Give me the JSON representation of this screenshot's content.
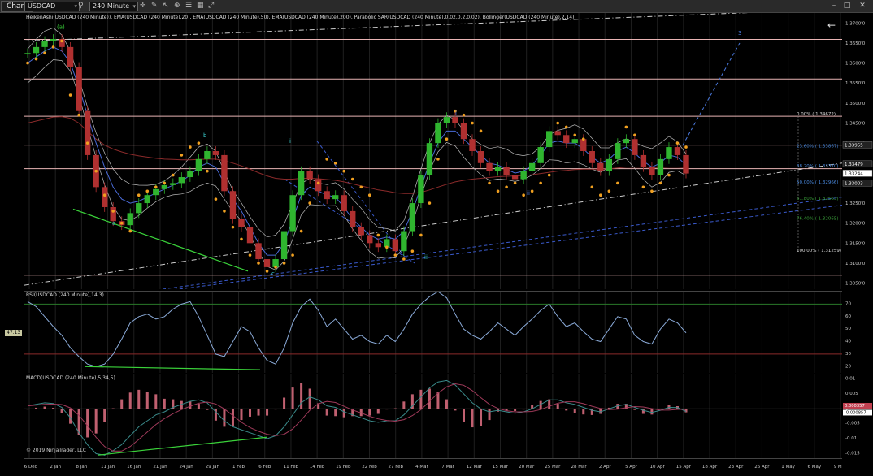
{
  "toolbar": {
    "chart_tab": "Chart",
    "instrument": "USDCAD",
    "timeframe": "240 Minute",
    "icons": [
      "search-icon",
      "crosshair-icon",
      "draw-tools-icon",
      "pointer-icon",
      "zoom-icon",
      "properties-icon"
    ]
  },
  "colors": {
    "background": "#000000",
    "grid": "#1f1f1f",
    "candle_up": "#2fb52f",
    "candle_down": "#b03030",
    "psar": "#f0a020",
    "ema20": "#4a6bd8",
    "ema50": "#2a3a8a",
    "ema200": "#8a2a2a",
    "bollinger": "#bbbbbb",
    "sr_line": "#e8b4b4",
    "fib_text": "#4a8ae0",
    "trend_green": "#3ad23a",
    "rsi_line": "#8aaad8",
    "macd_hist": "#c06070"
  },
  "chart_data": [
    {
      "type": "line",
      "panel": "price",
      "title": "HeikenAshi(USDCAD (240 Minute)), EMA(USDCAD (240 Minute),20), EMA(USDCAD (240 Minute),50), EMA(USDCAD (240 Minute),200), Parabolic SAR(USDCAD (240 Minute),0.02,0.2,0.02), Bollinger(USDCAD (240 Minute),2,14)",
      "x_tick_labels": [
        "26 Dec",
        "2 Jan",
        "8 Jan",
        "11 Jan",
        "16 Jan",
        "21 Jan",
        "24 Jan",
        "29 Jan",
        "1 Feb",
        "6 Feb",
        "11 Feb",
        "14 Feb",
        "19 Feb",
        "22 Feb",
        "27 Feb",
        "4 Mar",
        "7 Mar",
        "12 Mar",
        "15 Mar",
        "20 Mar",
        "25 Mar",
        "28 Mar",
        "2 Apr",
        "5 Apr",
        "10 Apr",
        "15 Apr",
        "18 Apr",
        "23 Apr",
        "26 Apr",
        "1 May",
        "6 May",
        "9 May"
      ],
      "y_tick_labels": [
        "1.3700'0",
        "1.3650'0",
        "1.3600'0",
        "1.3550'0",
        "1.3500'0",
        "1.3450'0",
        "1.3400'0",
        "1.3350'0",
        "1.3300'0",
        "1.3250'0",
        "1.3200'0",
        "1.3150'0",
        "1.3100'0",
        "1.3050'0"
      ],
      "ylim": [
        1.3035,
        1.3725
      ],
      "last_price_labels": [
        "1.33955",
        "1.33479",
        "1.33244",
        "1.33003"
      ],
      "series_close": [
        1.3625,
        1.364,
        1.3655,
        1.366,
        1.364,
        1.359,
        1.348,
        1.337,
        1.329,
        1.324,
        1.3205,
        1.3195,
        1.3225,
        1.325,
        1.327,
        1.3285,
        1.3295,
        1.33,
        1.3315,
        1.333,
        1.336,
        1.338,
        1.337,
        1.328,
        1.321,
        1.319,
        1.315,
        1.311,
        1.309,
        1.311,
        1.318,
        1.327,
        1.333,
        1.331,
        1.328,
        1.326,
        1.327,
        1.323,
        1.319,
        1.317,
        1.315,
        1.314,
        1.316,
        1.313,
        1.318,
        1.325,
        1.332,
        1.34,
        1.345,
        1.3465,
        1.345,
        1.341,
        1.338,
        1.335,
        1.333,
        1.334,
        1.332,
        1.331,
        1.333,
        1.335,
        1.339,
        1.343,
        1.342,
        1.34,
        1.341,
        1.338,
        1.335,
        1.333,
        1.336,
        1.34,
        1.341,
        1.337,
        1.334,
        1.332,
        1.336,
        1.339,
        1.337,
        1.3324
      ],
      "series_psar": [
        1.36,
        1.361,
        1.3625,
        1.364,
        1.3655,
        1.352,
        1.347,
        1.34,
        1.333,
        1.327,
        1.323,
        1.32,
        1.318,
        1.327,
        1.328,
        1.329,
        1.33,
        1.332,
        1.337,
        1.339,
        1.34,
        1.333,
        1.326,
        1.323,
        1.319,
        1.316,
        1.312,
        1.31,
        1.308,
        1.309,
        1.31,
        1.312,
        1.318,
        1.325,
        1.33,
        1.336,
        1.335,
        1.333,
        1.331,
        1.329,
        1.327,
        1.317,
        1.314,
        1.312,
        1.311,
        1.313,
        1.317,
        1.325,
        1.336,
        1.341,
        1.348,
        1.347,
        1.345,
        1.343,
        1.33,
        1.328,
        1.329,
        1.33,
        1.327,
        1.328,
        1.33,
        1.332,
        1.345,
        1.344,
        1.342,
        1.341,
        1.329,
        1.327,
        1.328,
        1.33,
        1.344,
        1.342,
        1.329,
        1.328,
        1.33,
        1.332,
        1.34,
        1.339
      ],
      "ema20": [
        1.36,
        1.3615,
        1.363,
        1.364,
        1.363,
        1.36,
        1.354,
        1.347,
        1.34,
        1.334,
        1.329,
        1.326,
        1.325,
        1.3255,
        1.3265,
        1.3275,
        1.3285,
        1.3295,
        1.3305,
        1.332,
        1.334,
        1.335,
        1.334,
        1.33,
        1.326,
        1.323,
        1.319,
        1.315,
        1.312,
        1.312,
        1.315,
        1.321,
        1.327,
        1.329,
        1.328,
        1.327,
        1.3265,
        1.324,
        1.321,
        1.319,
        1.317,
        1.316,
        1.3165,
        1.316,
        1.318,
        1.323,
        1.329,
        1.335,
        1.34,
        1.343,
        1.343,
        1.341,
        1.339,
        1.337,
        1.335,
        1.3345,
        1.3335,
        1.3325,
        1.333,
        1.3345,
        1.337,
        1.34,
        1.3405,
        1.34,
        1.34,
        1.3385,
        1.3365,
        1.335,
        1.336,
        1.338,
        1.339,
        1.3375,
        1.3355,
        1.334,
        1.335,
        1.337,
        1.3365,
        1.3345
      ],
      "ema200": [
        1.345,
        1.3455,
        1.346,
        1.3465,
        1.3466,
        1.3462,
        1.345,
        1.343,
        1.341,
        1.3395,
        1.3385,
        1.3378,
        1.3372,
        1.3368,
        1.3365,
        1.3362,
        1.336,
        1.3359,
        1.3358,
        1.3358,
        1.3359,
        1.336,
        1.336,
        1.3356,
        1.335,
        1.3343,
        1.3335,
        1.3326,
        1.3318,
        1.3312,
        1.331,
        1.331,
        1.3312,
        1.3312,
        1.3311,
        1.3309,
        1.3307,
        1.3303,
        1.3298,
        1.3293,
        1.3288,
        1.3283,
        1.328,
        1.3276,
        1.3274,
        1.3274,
        1.3277,
        1.3283,
        1.329,
        1.3297,
        1.3303,
        1.3307,
        1.331,
        1.3312,
        1.3314,
        1.3316,
        1.3317,
        1.3318,
        1.3319,
        1.3321,
        1.3324,
        1.3327,
        1.333,
        1.3332,
        1.3334,
        1.3335,
        1.3335,
        1.3335,
        1.3336,
        1.3338,
        1.334,
        1.334,
        1.334,
        1.3339,
        1.3339,
        1.334,
        1.334,
        1.3339
      ],
      "horizontal_levels": [
        1.3659,
        1.356,
        1.3467,
        1.3395,
        1.3336,
        1.307
      ],
      "fibonacci": [
        {
          "label": "0.00% ( 1.34672)",
          "value": 1.34672
        },
        {
          "label": "23.60% ( 1.33867)",
          "value": 1.33867
        },
        {
          "label": "38.20% ( 1.33370)",
          "value": 1.3337
        },
        {
          "label": "50.00% ( 1.32966)",
          "value": 1.32966
        },
        {
          "label": "61.80% ( 1.32563)",
          "value": 1.32563
        },
        {
          "label": "76.40% ( 1.32065)",
          "value": 1.32065
        },
        {
          "label": "100.00% ( 1.31259)",
          "value": 1.31259
        }
      ],
      "wave_labels": [
        "(a)",
        "a",
        "b",
        "c",
        "i",
        "ii",
        "i",
        "ii",
        "3"
      ],
      "copyright": "© 2019 NinjaTrader, LLC"
    },
    {
      "type": "line",
      "panel": "rsi",
      "title": "RSI(USDCAD (240 Minute),14,3)",
      "y_tick_labels": [
        "70",
        "60",
        "50",
        "40",
        "30",
        "20"
      ],
      "ylim": [
        15,
        80
      ],
      "levels": [
        70,
        30
      ],
      "current_value_label": "47.13",
      "values": [
        72,
        68,
        60,
        52,
        45,
        35,
        28,
        22,
        20,
        22,
        30,
        42,
        55,
        60,
        62,
        58,
        60,
        66,
        70,
        72,
        60,
        45,
        30,
        28,
        40,
        52,
        48,
        35,
        25,
        22,
        35,
        55,
        68,
        74,
        65,
        52,
        58,
        50,
        42,
        45,
        40,
        38,
        45,
        40,
        50,
        62,
        70,
        76,
        80,
        75,
        62,
        50,
        45,
        42,
        48,
        55,
        50,
        45,
        52,
        58,
        65,
        70,
        60,
        52,
        55,
        48,
        42,
        40,
        50,
        60,
        58,
        45,
        40,
        38,
        50,
        58,
        55,
        47
      ]
    },
    {
      "type": "bar",
      "panel": "macd",
      "title": "MACD(USDCAD (240 Minute),5,34,5)",
      "y_tick_labels": [
        "0.01",
        "0.005",
        "0",
        "-0.005",
        "-0.01",
        "-0.015"
      ],
      "ylim": [
        -0.0165,
        0.0115
      ],
      "current_value_labels": [
        "0.000357",
        "-0.000857"
      ],
      "macd": [
        0.001,
        0.0015,
        0.002,
        0.0018,
        0.0005,
        -0.003,
        -0.008,
        -0.012,
        -0.015,
        -0.0155,
        -0.014,
        -0.012,
        -0.009,
        -0.006,
        -0.004,
        -0.002,
        -0.001,
        0.0005,
        0.0015,
        0.0025,
        0.003,
        0.002,
        -0.001,
        -0.004,
        -0.006,
        -0.007,
        -0.008,
        -0.009,
        -0.01,
        -0.009,
        -0.006,
        -0.002,
        0.002,
        0.004,
        0.003,
        0.001,
        0.0005,
        -0.001,
        -0.002,
        -0.003,
        -0.004,
        -0.0045,
        -0.004,
        -0.004,
        -0.002,
        0.001,
        0.004,
        0.007,
        0.009,
        0.0095,
        0.008,
        0.005,
        0.002,
        0.0,
        -0.001,
        -0.0005,
        -0.001,
        -0.0015,
        -0.001,
        0.0,
        0.0015,
        0.003,
        0.003,
        0.002,
        0.0015,
        0.0005,
        -0.0005,
        -0.001,
        0.0,
        0.001,
        0.0015,
        0.0005,
        -0.0005,
        -0.0012,
        -0.0005,
        0.0005,
        0.0004,
        -0.0009
      ]
    }
  ]
}
